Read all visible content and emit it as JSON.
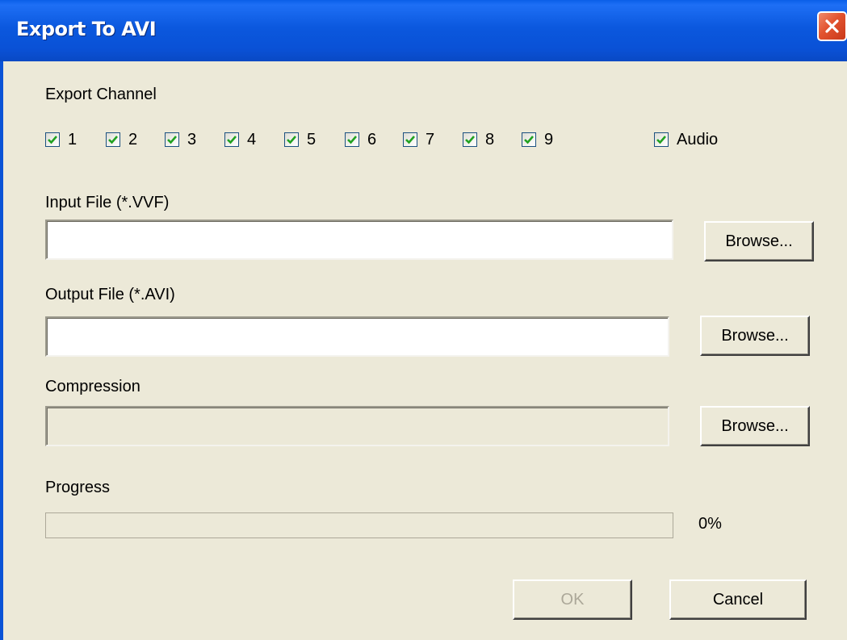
{
  "window": {
    "title": "Export To AVI",
    "close_icon": "close-icon"
  },
  "export_channel": {
    "label": "Export Channel",
    "channels": [
      {
        "label": "1",
        "checked": true
      },
      {
        "label": "2",
        "checked": true
      },
      {
        "label": "3",
        "checked": true
      },
      {
        "label": "4",
        "checked": true
      },
      {
        "label": "5",
        "checked": true
      },
      {
        "label": "6",
        "checked": true
      },
      {
        "label": "7",
        "checked": true
      },
      {
        "label": "8",
        "checked": true
      },
      {
        "label": "9",
        "checked": true
      }
    ],
    "audio": {
      "label": "Audio",
      "checked": true
    }
  },
  "input_file": {
    "label": "Input File (*.VVF)",
    "value": "",
    "browse_label": "Browse..."
  },
  "output_file": {
    "label": "Output File (*.AVI)",
    "value": "",
    "browse_label": "Browse..."
  },
  "compression": {
    "label": "Compression",
    "value": "",
    "browse_label": "Browse..."
  },
  "progress": {
    "label": "Progress",
    "value": 0,
    "percent_text": "0%"
  },
  "buttons": {
    "ok_label": "OK",
    "ok_enabled": false,
    "cancel_label": "Cancel"
  },
  "colors": {
    "titlebar": "#0a51d6",
    "dialog_bg": "#ece9d8",
    "close_button": "#e2532f",
    "disabled_text": "#aca899"
  }
}
